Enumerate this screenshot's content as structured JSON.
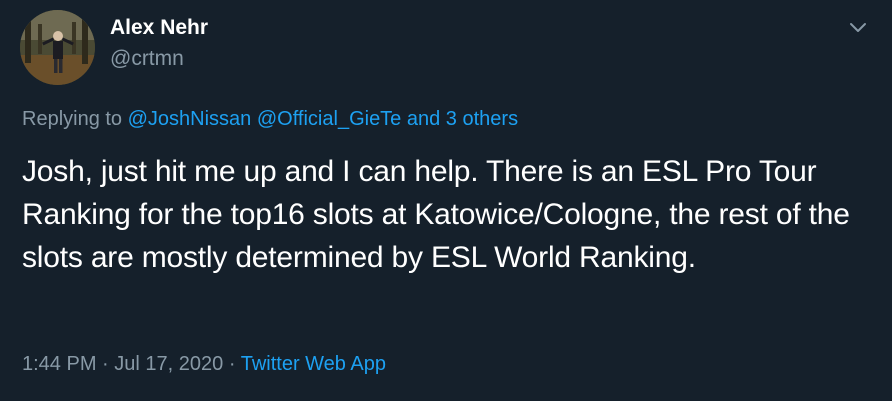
{
  "tweet": {
    "author": {
      "display_name": "Alex Nehr",
      "handle": "@crtmn"
    },
    "replying": {
      "prefix": "Replying to",
      "mentions": [
        "@JoshNissan",
        "@Official_GieTe"
      ],
      "others": "and 3 others"
    },
    "text": "Josh, just hit me up and I can help. There is an ESL Pro Tour Ranking for the top16 slots at Katowice/Cologne, the rest of the slots are mostly determined by ESL World Ranking.",
    "time": "1:44 PM",
    "separator": "·",
    "date": "Jul 17, 2020",
    "source": "Twitter Web App",
    "menu_icon": "chevron-down-icon",
    "colors": {
      "background": "#15202b",
      "text": "#ffffff",
      "secondary": "#8899a6",
      "link": "#1da1f2"
    }
  }
}
